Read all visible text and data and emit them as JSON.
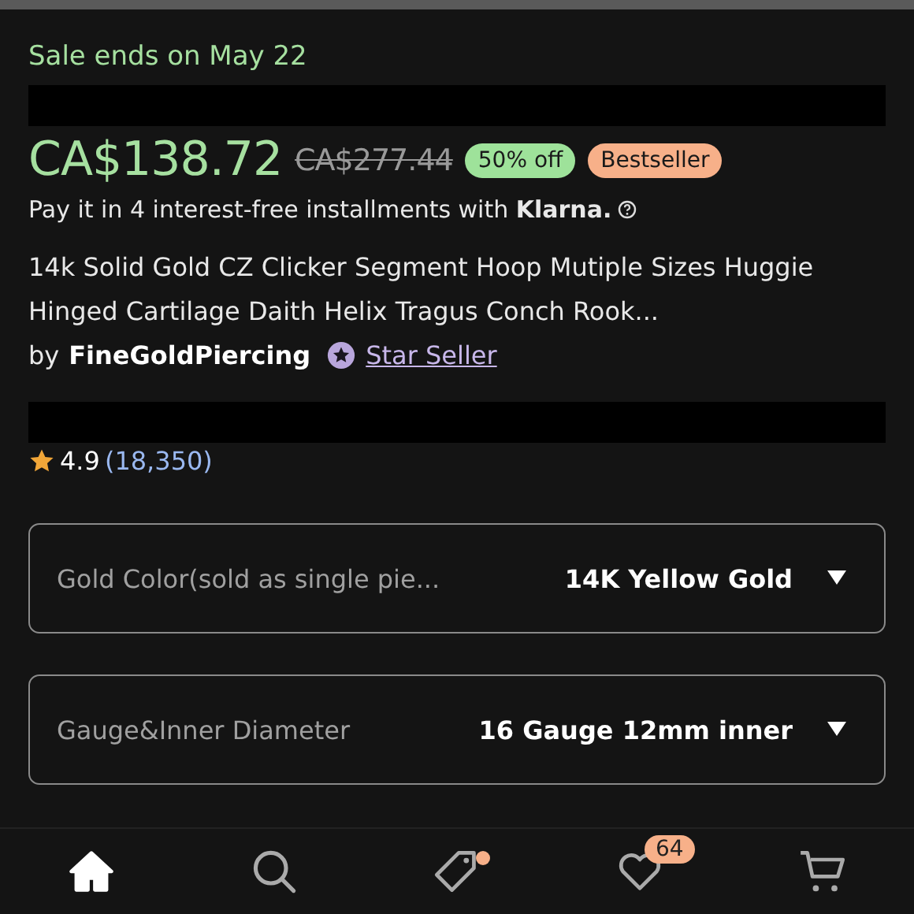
{
  "sale_notice": "Sale ends on May 22",
  "price": {
    "current": "CA$138.72",
    "original": "CA$277.44",
    "discount": "50% off",
    "badge": "Bestseller"
  },
  "installments": "Pay it in 4 interest-free installments with **Klarna.**",
  "title": "14k Solid Gold CZ Clicker Segment Hoop Mutiple Sizes Huggie Hinged Cartilage Daith Helix Tragus Conch Rook...",
  "seller": {
    "prefix": "by",
    "name": "FineGoldPiercing",
    "badge_link": "Star Seller"
  },
  "rating": {
    "score": "4.9",
    "count": "(18,350)"
  },
  "options": [
    {
      "label": "Gold Color(sold as single pie...",
      "value": "14K Yellow Gold"
    },
    {
      "label": "Gauge&Inner Diameter",
      "value": "16 Gauge 12mm inner"
    }
  ],
  "nav": [
    {
      "kind": "home",
      "selected": true
    },
    {
      "kind": "search",
      "selected": false
    },
    {
      "kind": "deals",
      "selected": false,
      "dot": true
    },
    {
      "kind": "favorites",
      "selected": false,
      "badge": "64"
    },
    {
      "kind": "cart",
      "selected": false
    }
  ]
}
